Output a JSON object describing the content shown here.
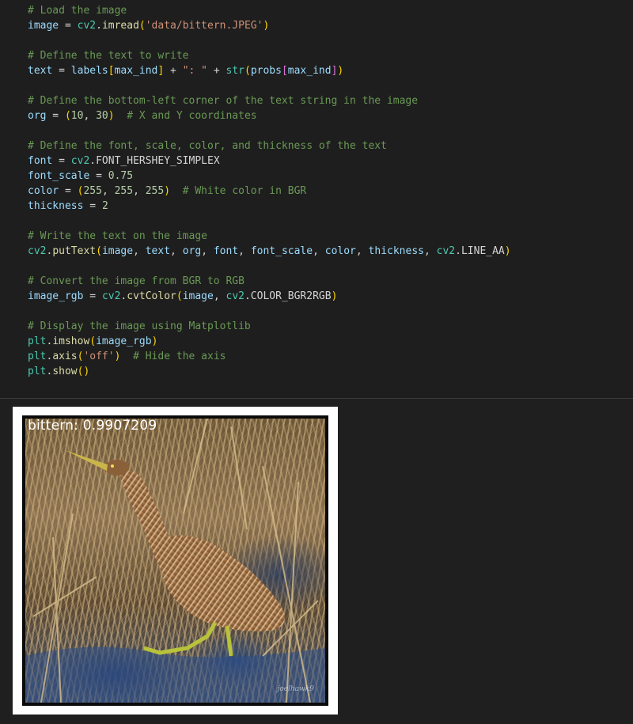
{
  "code_lines": [
    [
      {
        "t": "# Load the image",
        "c": "c"
      }
    ],
    [
      {
        "t": "image",
        "c": "v"
      },
      {
        "t": " = ",
        "c": "p"
      },
      {
        "t": "cv2",
        "c": "m"
      },
      {
        "t": ".",
        "c": "p"
      },
      {
        "t": "imread",
        "c": "f"
      },
      {
        "t": "(",
        "c": "b1"
      },
      {
        "t": "'data/bittern.JPEG'",
        "c": "s"
      },
      {
        "t": ")",
        "c": "b1"
      }
    ],
    [],
    [
      {
        "t": "# Define the text to write",
        "c": "c"
      }
    ],
    [
      {
        "t": "text",
        "c": "v"
      },
      {
        "t": " = ",
        "c": "p"
      },
      {
        "t": "labels",
        "c": "v"
      },
      {
        "t": "[",
        "c": "b1"
      },
      {
        "t": "max_ind",
        "c": "v"
      },
      {
        "t": "]",
        "c": "b1"
      },
      {
        "t": " + ",
        "c": "p"
      },
      {
        "t": "\": \"",
        "c": "s"
      },
      {
        "t": " + ",
        "c": "p"
      },
      {
        "t": "str",
        "c": "m"
      },
      {
        "t": "(",
        "c": "b1"
      },
      {
        "t": "probs",
        "c": "v"
      },
      {
        "t": "[",
        "c": "b2"
      },
      {
        "t": "max_ind",
        "c": "v"
      },
      {
        "t": "]",
        "c": "b2"
      },
      {
        "t": ")",
        "c": "b1"
      }
    ],
    [],
    [
      {
        "t": "# Define the bottom-left corner of the text string in the image",
        "c": "c"
      }
    ],
    [
      {
        "t": "org",
        "c": "v"
      },
      {
        "t": " = ",
        "c": "p"
      },
      {
        "t": "(",
        "c": "b1"
      },
      {
        "t": "10",
        "c": "n"
      },
      {
        "t": ", ",
        "c": "p"
      },
      {
        "t": "30",
        "c": "n"
      },
      {
        "t": ")",
        "c": "b1"
      },
      {
        "t": "  # X and Y coordinates",
        "c": "c"
      }
    ],
    [],
    [
      {
        "t": "# Define the font, scale, color, and thickness of the text",
        "c": "c"
      }
    ],
    [
      {
        "t": "font",
        "c": "v"
      },
      {
        "t": " = ",
        "c": "p"
      },
      {
        "t": "cv2",
        "c": "m"
      },
      {
        "t": ".FONT_HERSHEY_SIMPLEX",
        "c": "p"
      }
    ],
    [
      {
        "t": "font_scale",
        "c": "v"
      },
      {
        "t": " = ",
        "c": "p"
      },
      {
        "t": "0.75",
        "c": "n"
      }
    ],
    [
      {
        "t": "color",
        "c": "v"
      },
      {
        "t": " = ",
        "c": "p"
      },
      {
        "t": "(",
        "c": "b1"
      },
      {
        "t": "255",
        "c": "n"
      },
      {
        "t": ", ",
        "c": "p"
      },
      {
        "t": "255",
        "c": "n"
      },
      {
        "t": ", ",
        "c": "p"
      },
      {
        "t": "255",
        "c": "n"
      },
      {
        "t": ")",
        "c": "b1"
      },
      {
        "t": "  # White color in BGR",
        "c": "c"
      }
    ],
    [
      {
        "t": "thickness",
        "c": "v"
      },
      {
        "t": " = ",
        "c": "p"
      },
      {
        "t": "2",
        "c": "n"
      }
    ],
    [],
    [
      {
        "t": "# Write the text on the image",
        "c": "c"
      }
    ],
    [
      {
        "t": "cv2",
        "c": "m"
      },
      {
        "t": ".",
        "c": "p"
      },
      {
        "t": "putText",
        "c": "f"
      },
      {
        "t": "(",
        "c": "b1"
      },
      {
        "t": "image",
        "c": "v"
      },
      {
        "t": ", ",
        "c": "p"
      },
      {
        "t": "text",
        "c": "v"
      },
      {
        "t": ", ",
        "c": "p"
      },
      {
        "t": "org",
        "c": "v"
      },
      {
        "t": ", ",
        "c": "p"
      },
      {
        "t": "font",
        "c": "v"
      },
      {
        "t": ", ",
        "c": "p"
      },
      {
        "t": "font_scale",
        "c": "v"
      },
      {
        "t": ", ",
        "c": "p"
      },
      {
        "t": "color",
        "c": "v"
      },
      {
        "t": ", ",
        "c": "p"
      },
      {
        "t": "thickness",
        "c": "v"
      },
      {
        "t": ", ",
        "c": "p"
      },
      {
        "t": "cv2",
        "c": "m"
      },
      {
        "t": ".LINE_AA",
        "c": "p"
      },
      {
        "t": ")",
        "c": "b1"
      }
    ],
    [],
    [
      {
        "t": "# Convert the image from BGR to RGB",
        "c": "c"
      }
    ],
    [
      {
        "t": "image_rgb",
        "c": "v"
      },
      {
        "t": " = ",
        "c": "p"
      },
      {
        "t": "cv2",
        "c": "m"
      },
      {
        "t": ".",
        "c": "p"
      },
      {
        "t": "cvtColor",
        "c": "f"
      },
      {
        "t": "(",
        "c": "b1"
      },
      {
        "t": "image",
        "c": "v"
      },
      {
        "t": ", ",
        "c": "p"
      },
      {
        "t": "cv2",
        "c": "m"
      },
      {
        "t": ".COLOR_BGR2RGB",
        "c": "p"
      },
      {
        "t": ")",
        "c": "b1"
      }
    ],
    [],
    [
      {
        "t": "# Display the image using Matplotlib",
        "c": "c"
      }
    ],
    [
      {
        "t": "plt",
        "c": "m"
      },
      {
        "t": ".",
        "c": "p"
      },
      {
        "t": "imshow",
        "c": "f"
      },
      {
        "t": "(",
        "c": "b1"
      },
      {
        "t": "image_rgb",
        "c": "v"
      },
      {
        "t": ")",
        "c": "b1"
      }
    ],
    [
      {
        "t": "plt",
        "c": "m"
      },
      {
        "t": ".",
        "c": "p"
      },
      {
        "t": "axis",
        "c": "f"
      },
      {
        "t": "(",
        "c": "b1"
      },
      {
        "t": "'off'",
        "c": "s"
      },
      {
        "t": ")",
        "c": "b1"
      },
      {
        "t": "  # Hide the axis",
        "c": "c"
      }
    ],
    [
      {
        "t": "plt",
        "c": "m"
      },
      {
        "t": ".",
        "c": "p"
      },
      {
        "t": "show",
        "c": "f"
      },
      {
        "t": "()",
        "c": "b1"
      }
    ]
  ],
  "output": {
    "image_label": "bittern: 0.9907209",
    "watermark": "joelhawk9"
  },
  "colors": {
    "editor_bg": "#1e1e1e",
    "comment": "#6a9955",
    "string": "#ce9178",
    "number": "#b5cea8",
    "variable": "#9cdcfe",
    "function": "#dcdcaa",
    "module": "#4ec9b0"
  }
}
